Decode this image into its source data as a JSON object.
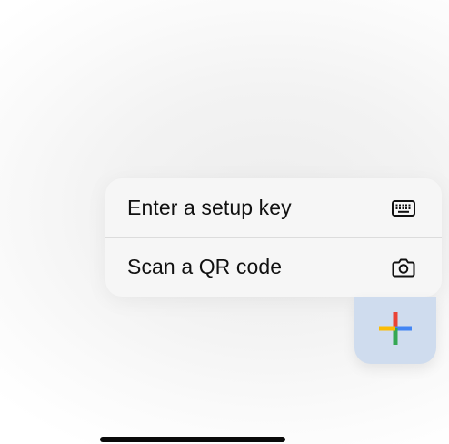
{
  "menu": {
    "items": [
      {
        "label": "Enter a setup key",
        "icon": "keyboard-icon"
      },
      {
        "label": "Scan a QR code",
        "icon": "camera-icon"
      }
    ]
  },
  "fab": {
    "icon": "google-plus-icon",
    "colors": {
      "red": "#ea4335",
      "blue": "#4285f4",
      "green": "#34a853",
      "yellow": "#fbbc05"
    }
  },
  "colors": {
    "menu_background": "#f6f6f6",
    "fab_background": "#cfdcee",
    "text": "#111111"
  }
}
